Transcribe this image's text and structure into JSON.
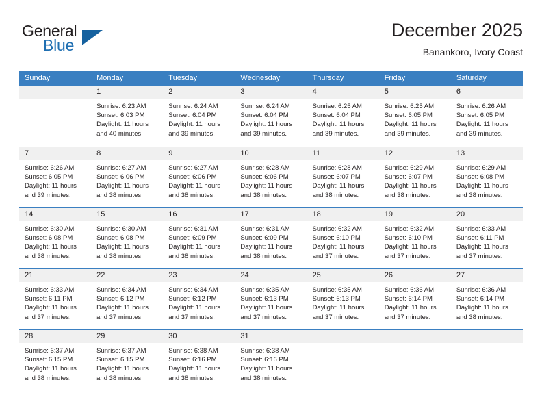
{
  "brand": {
    "name_part1": "General",
    "name_part2": "Blue",
    "accent_color": "#1f6fb2",
    "triangle_color": "#15619f"
  },
  "header": {
    "title": "December 2025",
    "subtitle": "Banankoro, Ivory Coast"
  },
  "calendar": {
    "header_bg": "#3a7fc1",
    "day_band_bg": "#f0f0f0",
    "weekdays": [
      "Sunday",
      "Monday",
      "Tuesday",
      "Wednesday",
      "Thursday",
      "Friday",
      "Saturday"
    ],
    "weeks": [
      [
        {
          "day": "",
          "sunrise": "",
          "sunset": "",
          "daylight": "",
          "daylight2": ""
        },
        {
          "day": "1",
          "sunrise": "Sunrise: 6:23 AM",
          "sunset": "Sunset: 6:03 PM",
          "daylight": "Daylight: 11 hours",
          "daylight2": "and 40 minutes."
        },
        {
          "day": "2",
          "sunrise": "Sunrise: 6:24 AM",
          "sunset": "Sunset: 6:04 PM",
          "daylight": "Daylight: 11 hours",
          "daylight2": "and 39 minutes."
        },
        {
          "day": "3",
          "sunrise": "Sunrise: 6:24 AM",
          "sunset": "Sunset: 6:04 PM",
          "daylight": "Daylight: 11 hours",
          "daylight2": "and 39 minutes."
        },
        {
          "day": "4",
          "sunrise": "Sunrise: 6:25 AM",
          "sunset": "Sunset: 6:04 PM",
          "daylight": "Daylight: 11 hours",
          "daylight2": "and 39 minutes."
        },
        {
          "day": "5",
          "sunrise": "Sunrise: 6:25 AM",
          "sunset": "Sunset: 6:05 PM",
          "daylight": "Daylight: 11 hours",
          "daylight2": "and 39 minutes."
        },
        {
          "day": "6",
          "sunrise": "Sunrise: 6:26 AM",
          "sunset": "Sunset: 6:05 PM",
          "daylight": "Daylight: 11 hours",
          "daylight2": "and 39 minutes."
        }
      ],
      [
        {
          "day": "7",
          "sunrise": "Sunrise: 6:26 AM",
          "sunset": "Sunset: 6:05 PM",
          "daylight": "Daylight: 11 hours",
          "daylight2": "and 39 minutes."
        },
        {
          "day": "8",
          "sunrise": "Sunrise: 6:27 AM",
          "sunset": "Sunset: 6:06 PM",
          "daylight": "Daylight: 11 hours",
          "daylight2": "and 38 minutes."
        },
        {
          "day": "9",
          "sunrise": "Sunrise: 6:27 AM",
          "sunset": "Sunset: 6:06 PM",
          "daylight": "Daylight: 11 hours",
          "daylight2": "and 38 minutes."
        },
        {
          "day": "10",
          "sunrise": "Sunrise: 6:28 AM",
          "sunset": "Sunset: 6:06 PM",
          "daylight": "Daylight: 11 hours",
          "daylight2": "and 38 minutes."
        },
        {
          "day": "11",
          "sunrise": "Sunrise: 6:28 AM",
          "sunset": "Sunset: 6:07 PM",
          "daylight": "Daylight: 11 hours",
          "daylight2": "and 38 minutes."
        },
        {
          "day": "12",
          "sunrise": "Sunrise: 6:29 AM",
          "sunset": "Sunset: 6:07 PM",
          "daylight": "Daylight: 11 hours",
          "daylight2": "and 38 minutes."
        },
        {
          "day": "13",
          "sunrise": "Sunrise: 6:29 AM",
          "sunset": "Sunset: 6:08 PM",
          "daylight": "Daylight: 11 hours",
          "daylight2": "and 38 minutes."
        }
      ],
      [
        {
          "day": "14",
          "sunrise": "Sunrise: 6:30 AM",
          "sunset": "Sunset: 6:08 PM",
          "daylight": "Daylight: 11 hours",
          "daylight2": "and 38 minutes."
        },
        {
          "day": "15",
          "sunrise": "Sunrise: 6:30 AM",
          "sunset": "Sunset: 6:08 PM",
          "daylight": "Daylight: 11 hours",
          "daylight2": "and 38 minutes."
        },
        {
          "day": "16",
          "sunrise": "Sunrise: 6:31 AM",
          "sunset": "Sunset: 6:09 PM",
          "daylight": "Daylight: 11 hours",
          "daylight2": "and 38 minutes."
        },
        {
          "day": "17",
          "sunrise": "Sunrise: 6:31 AM",
          "sunset": "Sunset: 6:09 PM",
          "daylight": "Daylight: 11 hours",
          "daylight2": "and 38 minutes."
        },
        {
          "day": "18",
          "sunrise": "Sunrise: 6:32 AM",
          "sunset": "Sunset: 6:10 PM",
          "daylight": "Daylight: 11 hours",
          "daylight2": "and 37 minutes."
        },
        {
          "day": "19",
          "sunrise": "Sunrise: 6:32 AM",
          "sunset": "Sunset: 6:10 PM",
          "daylight": "Daylight: 11 hours",
          "daylight2": "and 37 minutes."
        },
        {
          "day": "20",
          "sunrise": "Sunrise: 6:33 AM",
          "sunset": "Sunset: 6:11 PM",
          "daylight": "Daylight: 11 hours",
          "daylight2": "and 37 minutes."
        }
      ],
      [
        {
          "day": "21",
          "sunrise": "Sunrise: 6:33 AM",
          "sunset": "Sunset: 6:11 PM",
          "daylight": "Daylight: 11 hours",
          "daylight2": "and 37 minutes."
        },
        {
          "day": "22",
          "sunrise": "Sunrise: 6:34 AM",
          "sunset": "Sunset: 6:12 PM",
          "daylight": "Daylight: 11 hours",
          "daylight2": "and 37 minutes."
        },
        {
          "day": "23",
          "sunrise": "Sunrise: 6:34 AM",
          "sunset": "Sunset: 6:12 PM",
          "daylight": "Daylight: 11 hours",
          "daylight2": "and 37 minutes."
        },
        {
          "day": "24",
          "sunrise": "Sunrise: 6:35 AM",
          "sunset": "Sunset: 6:13 PM",
          "daylight": "Daylight: 11 hours",
          "daylight2": "and 37 minutes."
        },
        {
          "day": "25",
          "sunrise": "Sunrise: 6:35 AM",
          "sunset": "Sunset: 6:13 PM",
          "daylight": "Daylight: 11 hours",
          "daylight2": "and 37 minutes."
        },
        {
          "day": "26",
          "sunrise": "Sunrise: 6:36 AM",
          "sunset": "Sunset: 6:14 PM",
          "daylight": "Daylight: 11 hours",
          "daylight2": "and 37 minutes."
        },
        {
          "day": "27",
          "sunrise": "Sunrise: 6:36 AM",
          "sunset": "Sunset: 6:14 PM",
          "daylight": "Daylight: 11 hours",
          "daylight2": "and 38 minutes."
        }
      ],
      [
        {
          "day": "28",
          "sunrise": "Sunrise: 6:37 AM",
          "sunset": "Sunset: 6:15 PM",
          "daylight": "Daylight: 11 hours",
          "daylight2": "and 38 minutes."
        },
        {
          "day": "29",
          "sunrise": "Sunrise: 6:37 AM",
          "sunset": "Sunset: 6:15 PM",
          "daylight": "Daylight: 11 hours",
          "daylight2": "and 38 minutes."
        },
        {
          "day": "30",
          "sunrise": "Sunrise: 6:38 AM",
          "sunset": "Sunset: 6:16 PM",
          "daylight": "Daylight: 11 hours",
          "daylight2": "and 38 minutes."
        },
        {
          "day": "31",
          "sunrise": "Sunrise: 6:38 AM",
          "sunset": "Sunset: 6:16 PM",
          "daylight": "Daylight: 11 hours",
          "daylight2": "and 38 minutes."
        },
        {
          "day": "",
          "sunrise": "",
          "sunset": "",
          "daylight": "",
          "daylight2": ""
        },
        {
          "day": "",
          "sunrise": "",
          "sunset": "",
          "daylight": "",
          "daylight2": ""
        },
        {
          "day": "",
          "sunrise": "",
          "sunset": "",
          "daylight": "",
          "daylight2": ""
        }
      ]
    ]
  }
}
